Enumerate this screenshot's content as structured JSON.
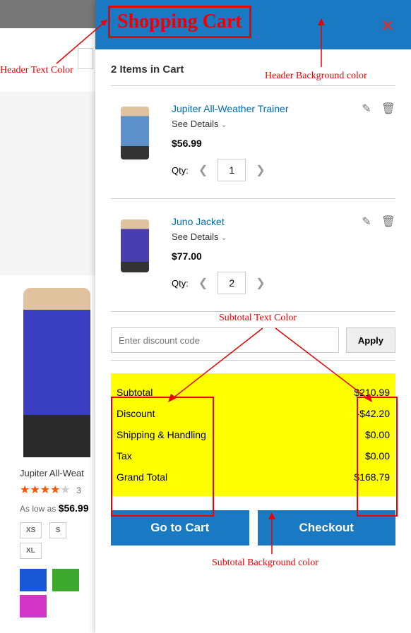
{
  "annotations": {
    "header_text": "Header Text Color",
    "header_bg": "Header Background color",
    "subtotal_text": "Subtotal Text Color",
    "subtotal_bg": "Subtotal Background color"
  },
  "cart": {
    "title": "Shopping Cart",
    "count_label": "2 Items in Cart",
    "items": [
      {
        "name": "Jupiter All-Weather Trainer",
        "see": "See Details",
        "price": "$56.99",
        "qty_label": "Qty:",
        "qty": "1"
      },
      {
        "name": "Juno Jacket",
        "see": "See Details",
        "price": "$77.00",
        "qty_label": "Qty:",
        "qty": "2"
      }
    ],
    "discount": {
      "placeholder": "Enter discount code",
      "apply": "Apply"
    },
    "totals": [
      {
        "label": "Subtotal",
        "value": "$210.99"
      },
      {
        "label": "Discount",
        "value": "-$42.20"
      },
      {
        "label": "Shipping & Handling",
        "value": "$0.00"
      },
      {
        "label": "Tax",
        "value": "$0.00"
      },
      {
        "label": "Grand Total",
        "value": "$168.79"
      }
    ],
    "go_to_cart": "Go to Cart",
    "checkout": "Checkout"
  },
  "product": {
    "title": "Jupiter All-Weat",
    "low_as": "As low as ",
    "price": "$56.99",
    "rcount": "3",
    "sizes": [
      "XS",
      "S",
      "XL"
    ]
  }
}
